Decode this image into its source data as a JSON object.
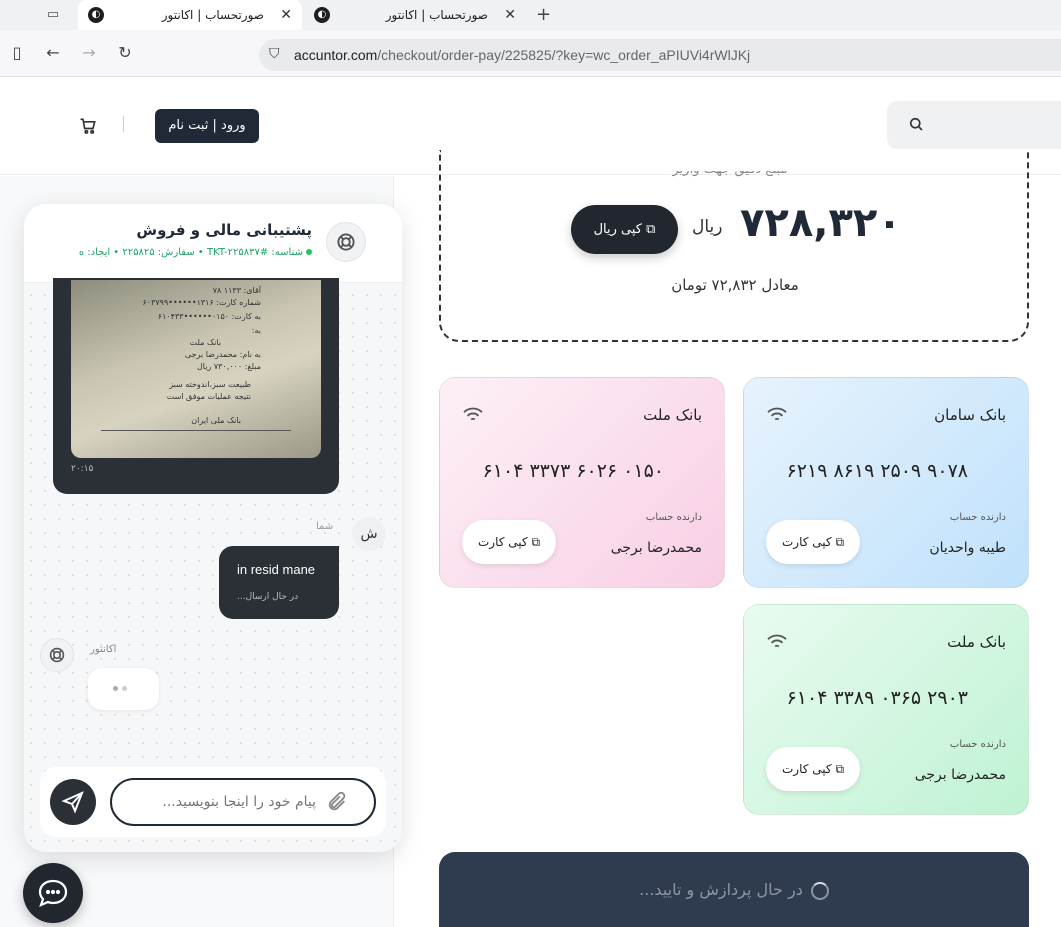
{
  "browser": {
    "tabs": [
      {
        "title": "صورتحساب | اکانتور",
        "active": true
      },
      {
        "title": "صورتحساب | اکانتور",
        "active": false
      }
    ],
    "url_domain": "accuntor.com",
    "url_path": "/checkout/order-pay/225825/?key=wc_order_aPIUVi4rWlJKj"
  },
  "header": {
    "login_label": "ورود | ثبت نام",
    "icons": [
      "cart-icon",
      "search-icon"
    ]
  },
  "payment": {
    "caption": "مبلغ دقیق جهت واریز",
    "amount": "۷۲۸,۳۲۰",
    "unit": "ریال",
    "copy_rial_label": "کپی ریال",
    "equivalent": "معادل ۷۲,۸۳۲ تومان",
    "processing_label": "در حال پردازش و تایید..."
  },
  "cards": [
    {
      "bank": "بانک ملت",
      "number": "۶۱۰۴ ۳۳۷۳ ۶۰۲۶ ۰۱۵۰",
      "holder_label": "دارنده حساب",
      "holder": "محمدرضا برجی",
      "copy_label": "کپی کارت",
      "color": "#f8cfe5"
    },
    {
      "bank": "بانک سامان",
      "number": "۶۲۱۹ ۸۶۱۹ ۲۵۰۹ ۹۰۷۸",
      "holder_label": "دارنده حساب",
      "holder": "طیبه واحدیان",
      "copy_label": "کپی کارت",
      "color": "#bfe1fb"
    },
    {
      "bank": "بانک ملت",
      "number": "۶۱۰۴ ۳۳۸۹ ۰۳۶۵ ۲۹۰۳",
      "holder_label": "دارنده حساب",
      "holder": "محمدرضا برجی",
      "copy_label": "کپی کارت",
      "color": "#bff2d3"
    }
  ],
  "chat": {
    "title": "پشتیبانی مالی و فروش",
    "meta": "شناسه: #TKT-۲۲۵۸۳۷ • سفارش: ۲۲۵۸۲۵ • ایجاد: ه",
    "receipt_time": "۲۰:۱۵",
    "you_label": "شما",
    "you_avatar": "ش",
    "my_message": "in resid mane",
    "my_status": "در حال ارسال...",
    "agent_label": "اکانتور",
    "input_placeholder": "پیام خود را اینجا بنویسید..."
  }
}
